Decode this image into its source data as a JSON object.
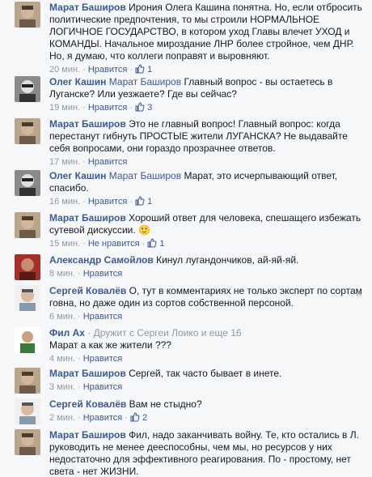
{
  "comments": [
    {
      "author": "Марат Баширов",
      "mention": "",
      "text": "Ирония Олега Кашина понятна. Но, если отбросить политические предпочтения, то мы строили НОРМАЛЬНОЕ ЛОГИЧНОЕ ГОСУДАРСТВО, в котором уход Главы влечет УХОД и КОМАНДЫ. Начальное мироздание ЛНР более стройное, чем ДНР. Но, я думаю, что коллеги поправят и выровняют.",
      "time": "20 мин.",
      "like": "Нравится",
      "likes": "1",
      "avatar": "marat"
    },
    {
      "author": "Олег Кашин",
      "mention": "Марат Баширов",
      "text": "Главный вопрос - вы остаетесь в Луганске? Или уезжаете? Где вы сейчас?",
      "time": "19 мин.",
      "like": "Нравится",
      "likes": "3",
      "avatar": "oleg"
    },
    {
      "author": "Марат Баширов",
      "mention": "",
      "text": "Это не главный вопрос! Главный вопрос: когда перестанут гибнуть ПРОСТЫЕ жители ЛУГАНСКА? Не выдавайте себя вопросами, они гораздо прозрачнее ответов.",
      "time": "17 мин.",
      "like": "Нравится",
      "likes": "",
      "avatar": "marat"
    },
    {
      "author": "Олег Кашин",
      "mention": "Марат Баширов",
      "text": "Марат, это исчерпывающий ответ, спасибо.",
      "time": "16 мин.",
      "like": "Нравится",
      "likes": "1",
      "avatar": "oleg"
    },
    {
      "author": "Марат Баширов",
      "mention": "",
      "text": "Хороший ответ для человека, спешащего избежать сутевой дискуссии.",
      "emoji": "🙂",
      "time": "15 мин.",
      "like": "Не нравится",
      "likes": "1",
      "avatar": "marat"
    },
    {
      "author": "Александр Самойлов",
      "mention": "",
      "text": "Кинул лугандончиков, ай-яй-яй.",
      "time": "8 мин.",
      "like": "Нравится",
      "likes": "",
      "avatar": "alex"
    },
    {
      "author": "Сергей Ковалёв",
      "mention": "",
      "text": "О, тут в комментариях не только эксперт по сортам говна, но даже один из сортов собственной персоной.",
      "time": "6 мин.",
      "like": "Нравится",
      "likes": "",
      "avatar": "sergey"
    },
    {
      "author": "Фил Ах",
      "mention": "",
      "friend": "· Дружит с Сергеи Лоико и еще 16",
      "text": "Марат а как же жители ???",
      "time": "4 мин.",
      "like": "Нравится",
      "likes": "",
      "avatar": "fil"
    },
    {
      "author": "Марат Баширов",
      "mention": "",
      "text": "Сергей, так часто бывает в инете.",
      "time": "3 мин.",
      "like": "Нравится",
      "likes": "",
      "avatar": "marat"
    },
    {
      "author": "Сергей Ковалёв",
      "mention": "",
      "text": "Вам не стыдно?",
      "time": "2 мин.",
      "like": "Нравится",
      "likes": "2",
      "avatar": "sergey"
    },
    {
      "author": "Марат Баширов",
      "mention": "",
      "text": "Фил, надо заканчивать войну. Те, кто остались в Л. руководить не менее дееспособны, чем мы, но ресурсов у них недостаточно для эффективного реагирования. По - простому, нет света - нет ЖИЗНИ.",
      "time": "",
      "like": "",
      "likes": "",
      "avatar": "marat"
    }
  ],
  "close_icon": "×",
  "colors": {
    "link": "#3b5998",
    "meta": "#9197a3",
    "text": "#141823",
    "bg": "#f6f7f9"
  }
}
